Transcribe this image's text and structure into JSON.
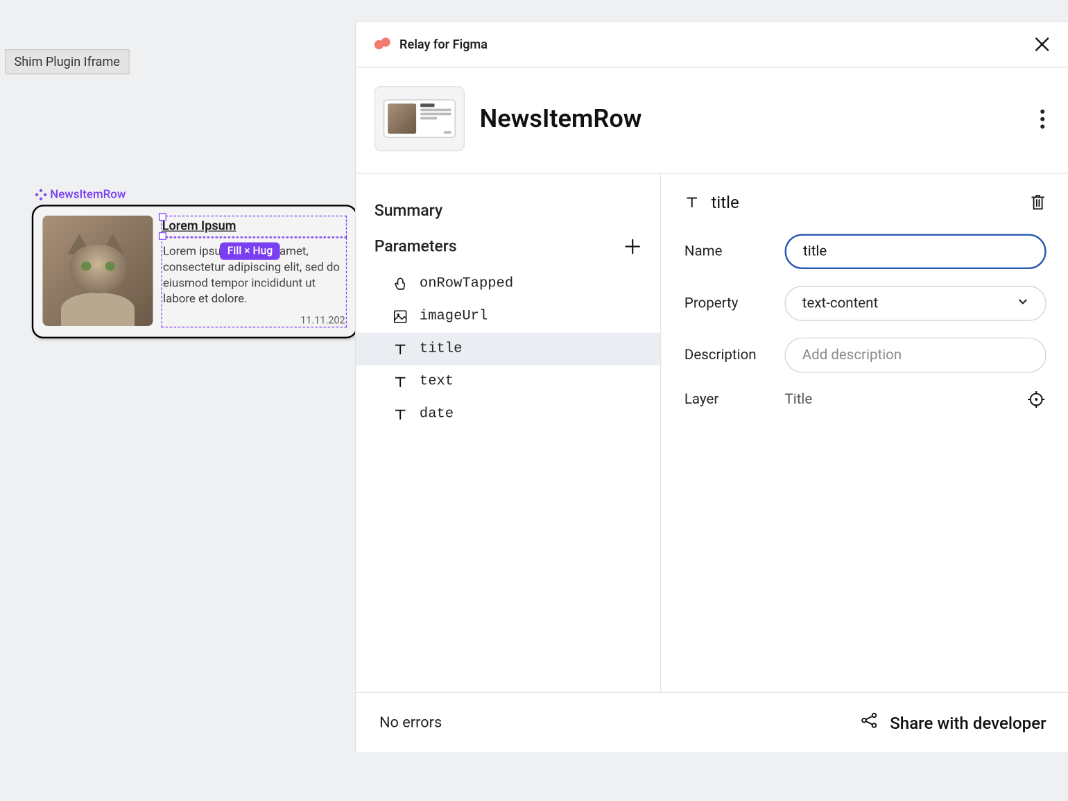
{
  "shim_badge": "Shim Plugin Iframe",
  "canvas": {
    "component_label": "NewsItemRow",
    "title": "Lorem Ipsum",
    "body": "Lorem ipsum dolor sit amet, consectetur adipiscing elit, sed do eiusmod tempor incididunt ut labore et dolore.",
    "date": "11.11.202",
    "fill_hug_badge": "Fill × Hug"
  },
  "panel": {
    "plugin_title": "Relay for Figma",
    "component_name": "NewsItemRow",
    "sections": {
      "summary_label": "Summary",
      "parameters_label": "Parameters"
    },
    "parameters": {
      "onRowTapped": "onRowTapped",
      "imageUrl": "imageUrl",
      "title": "title",
      "text": "text",
      "date": "date"
    },
    "detail": {
      "header_label": "title",
      "name_label": "Name",
      "name_value": "title",
      "property_label": "Property",
      "property_value": "text-content",
      "description_label": "Description",
      "description_placeholder": "Add description",
      "layer_label": "Layer",
      "layer_value": "Title"
    },
    "footer": {
      "status": "No errors",
      "share_label": "Share with developer"
    }
  }
}
